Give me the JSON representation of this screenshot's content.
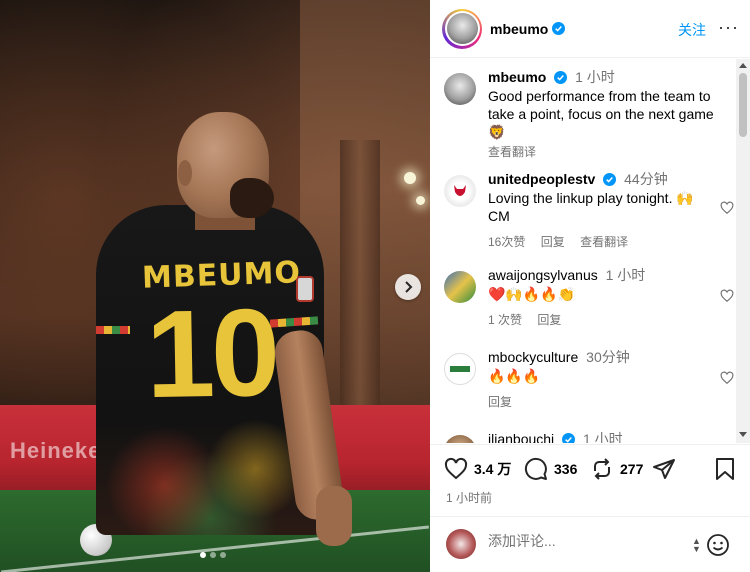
{
  "photo": {
    "shirt_name": "MBEUMO",
    "shirt_number": "10",
    "board_text": "Heineken",
    "carousel_dots": 3
  },
  "header": {
    "username": "mbeumo",
    "follow_label": "关注",
    "more_label": "···"
  },
  "comments": [
    {
      "username": "mbeumo",
      "time": "1 小时",
      "text": "Good performance from the team to take a point, focus on the next game 🦁",
      "translate": "查看翻译",
      "verified": true
    },
    {
      "username": "unitedpeoplestv",
      "time": "44分钟",
      "text": "Loving the linkup play tonight. 🙌CM",
      "likes": "16次赞",
      "reply": "回复",
      "translate": "查看翻译",
      "verified": true
    },
    {
      "username": "awaijongsylvanus",
      "time": "1 小时",
      "text": "❤️🙌🔥🔥👏",
      "likes": "1 次赞",
      "reply": "回复",
      "verified": false
    },
    {
      "username": "mbockyculture",
      "time": "30分钟",
      "text": "🔥🔥🔥",
      "reply": "回复",
      "verified": false
    },
    {
      "username": "ilianbouchi",
      "time": "1 小时",
      "verified": true
    }
  ],
  "actions": {
    "likes": "3.4 万",
    "comments": "336",
    "reposts": "277",
    "time_ago": "1 小时前"
  },
  "add_comment": {
    "placeholder": "添加评论..."
  },
  "colors": {
    "accent": "#0095f6",
    "verified": "#0095f6",
    "shirt_text": "#e8c43a"
  }
}
